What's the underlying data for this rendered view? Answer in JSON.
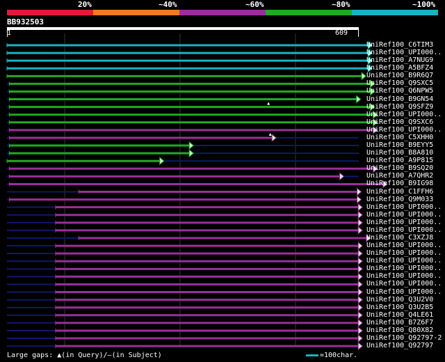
{
  "colors": {
    "background": "#000000",
    "grid": "#333333",
    "track": "#0c1a6a",
    "cyan": "#18b4c0",
    "green": "#22aa22",
    "purple": "#9a2f9a",
    "arrow_fill": "#ccffcc",
    "scale": [
      "#e01a3a",
      "#f07a20",
      "#9a2f9a",
      "#22aa22",
      "#18b4c0"
    ]
  },
  "scale_labels": [
    "20%",
    "~40%",
    "~60%",
    "~80%",
    "~100%"
  ],
  "query": {
    "name": "BB932503",
    "start": "1",
    "end": "609"
  },
  "hits": [
    {
      "label": "UniRef100_C6TIM3",
      "start": 1,
      "end": 631,
      "color": "cyan"
    },
    {
      "label": "UniRef100_UPI000..",
      "start": 1,
      "end": 631,
      "color": "cyan"
    },
    {
      "label": "UniRef100_A7NUG9",
      "start": 1,
      "end": 631,
      "color": "cyan"
    },
    {
      "label": "UniRef100_A5BFZ4",
      "start": 1,
      "end": 631,
      "color": "cyan"
    },
    {
      "label": "UniRef100_B9R6Q7",
      "start": 1,
      "end": 620,
      "color": "green"
    },
    {
      "label": "UniRef100_Q9SXC5",
      "start": 5,
      "end": 635,
      "color": "green"
    },
    {
      "label": "UniRef100_Q6NPW5",
      "start": 5,
      "end": 635,
      "color": "green"
    },
    {
      "label": "UniRef100_B9GN54",
      "start": 5,
      "end": 611,
      "color": "green"
    },
    {
      "label": "UniRef100_Q9SFZ9",
      "start": 5,
      "end": 635,
      "color": "green",
      "gap_query": 453
    },
    {
      "label": "UniRef100_UPI000..",
      "start": 5,
      "end": 640,
      "color": "green"
    },
    {
      "label": "UniRef100_Q9SXC6",
      "start": 5,
      "end": 640,
      "color": "green"
    },
    {
      "label": "UniRef100_UPI000..",
      "start": 5,
      "end": 640,
      "color": "purple"
    },
    {
      "label": "UniRef100_C5XHH0",
      "start": 5,
      "end": 465,
      "color": "purple",
      "gap_query": 456
    },
    {
      "label": "UniRef100_B9EYY5",
      "start": 5,
      "end": 322,
      "color": "green"
    },
    {
      "label": "UniRef100_B8A810",
      "start": 5,
      "end": 322,
      "color": "green"
    },
    {
      "label": "UniRef100_A9P815",
      "start": 1,
      "end": 271,
      "color": "green"
    },
    {
      "label": "UniRef100_B9SQ20",
      "start": 5,
      "end": 640,
      "color": "purple"
    },
    {
      "label": "UniRef100_A7QHR2",
      "start": 5,
      "end": 582,
      "color": "purple"
    },
    {
      "label": "UniRef100_B9IG98",
      "start": 5,
      "end": 657,
      "color": "purple"
    },
    {
      "label": "UniRef100_C1FFH6",
      "start": 125,
      "end": 612,
      "color": "purple"
    },
    {
      "label": "UniRef100_Q9M033",
      "start": 5,
      "end": 612,
      "color": "purple"
    },
    {
      "label": "UniRef100_UPI000..",
      "start": 85,
      "end": 614,
      "color": "purple"
    },
    {
      "label": "UniRef100_UPI000..",
      "start": 85,
      "end": 614,
      "color": "purple"
    },
    {
      "label": "UniRef100_UPI000..",
      "start": 85,
      "end": 614,
      "color": "purple"
    },
    {
      "label": "UniRef100_UPI000..",
      "start": 85,
      "end": 614,
      "color": "purple"
    },
    {
      "label": "UniRef100_C3XZJ8",
      "start": 125,
      "end": 628,
      "color": "purple"
    },
    {
      "label": "UniRef100_UPI000..",
      "start": 85,
      "end": 614,
      "color": "purple"
    },
    {
      "label": "UniRef100_UPI000..",
      "start": 85,
      "end": 614,
      "color": "purple"
    },
    {
      "label": "UniRef100_UPI000..",
      "start": 85,
      "end": 614,
      "color": "purple"
    },
    {
      "label": "UniRef100_UPI000..",
      "start": 85,
      "end": 614,
      "color": "purple"
    },
    {
      "label": "UniRef100_UPI000..",
      "start": 85,
      "end": 614,
      "color": "purple"
    },
    {
      "label": "UniRef100_UPI000..",
      "start": 85,
      "end": 614,
      "color": "purple"
    },
    {
      "label": "UniRef100_UPI000..",
      "start": 85,
      "end": 614,
      "color": "purple"
    },
    {
      "label": "UniRef100_Q3U2V0",
      "start": 85,
      "end": 614,
      "color": "purple"
    },
    {
      "label": "UniRef100_Q3U2B5",
      "start": 85,
      "end": 614,
      "color": "purple"
    },
    {
      "label": "UniRef100_Q4LE61",
      "start": 85,
      "end": 614,
      "color": "purple"
    },
    {
      "label": "UniRef100_B7Z6F7",
      "start": 85,
      "end": 614,
      "color": "purple"
    },
    {
      "label": "UniRef100_Q80X82",
      "start": 85,
      "end": 614,
      "color": "purple"
    },
    {
      "label": "UniRef100_Q92797-2",
      "start": 85,
      "end": 614,
      "color": "purple"
    },
    {
      "label": "UniRef100_Q92797",
      "start": 85,
      "end": 614,
      "color": "purple"
    }
  ],
  "footer": {
    "large_gaps_label": "Large gaps:",
    "gap_query_symbol": "▲",
    "gap_query_text": "(in Query)/",
    "gap_subject_symbol": "–",
    "gap_subject_text": "(in Subject)",
    "legend_icon": "scale-bar-icon",
    "legend_text": "=100char."
  }
}
